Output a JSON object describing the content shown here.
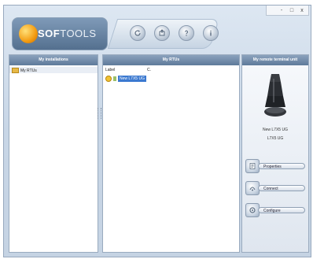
{
  "window": {
    "controls": [
      "-",
      "□",
      "x"
    ]
  },
  "header": {
    "logo_bold": "SOF",
    "logo_rest": "TOOLS",
    "toolbar_icons": [
      "refresh-icon",
      "export-icon",
      "help-icon",
      "info-icon"
    ]
  },
  "panels": {
    "installations": {
      "title": "My installations",
      "items": [
        {
          "label": "My RTUs"
        }
      ]
    },
    "rtus": {
      "title": "My RTUs",
      "columns": [
        "Label",
        "C."
      ],
      "rows": [
        {
          "label": "New L7X5 UG"
        }
      ]
    },
    "remote": {
      "title": "My remote terminal unit",
      "device_name": "New L7X5 UG",
      "device_model": "L7X5 UG",
      "actions": [
        {
          "label": "Properties",
          "icon": "properties-icon"
        },
        {
          "label": "Connect",
          "icon": "connect-icon"
        },
        {
          "label": "Configure",
          "icon": "configure-icon"
        }
      ]
    }
  }
}
